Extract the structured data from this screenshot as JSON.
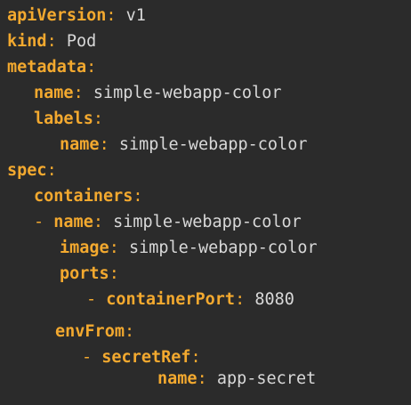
{
  "yaml": {
    "line1": {
      "key": "apiVersion",
      "colon": ":",
      "value": "v1"
    },
    "line2": {
      "key": "kind",
      "colon": ":",
      "value": "Pod"
    },
    "line3": {
      "key": "metadata",
      "colon": ":"
    },
    "line4": {
      "key": "name",
      "colon": ":",
      "value": "simple-webapp-color"
    },
    "line5": {
      "key": "labels",
      "colon": ":"
    },
    "line6": {
      "key": "name",
      "colon": ":",
      "value": "simple-webapp-color"
    },
    "line7": {
      "key": "spec",
      "colon": ":"
    },
    "line8": {
      "key": "containers",
      "colon": ":"
    },
    "line9": {
      "dash": "-",
      "key": "name",
      "colon": ":",
      "value": "simple-webapp-color"
    },
    "line10": {
      "key": "image",
      "colon": ":",
      "value": "simple-webapp-color"
    },
    "line11": {
      "key": "ports",
      "colon": ":"
    },
    "line12": {
      "dash": "-",
      "key": "containerPort",
      "colon": ":",
      "value": "8080"
    },
    "line13": {
      "key": "envFrom",
      "colon": ":"
    },
    "line14": {
      "dash": "-",
      "key": "secretRef",
      "colon": ":"
    },
    "line15": {
      "key": "name",
      "colon": ":",
      "value": "app-secret"
    }
  },
  "colors": {
    "background": "#2b2b2b",
    "key": "#f3a92f",
    "value": "#d8d8d8"
  }
}
